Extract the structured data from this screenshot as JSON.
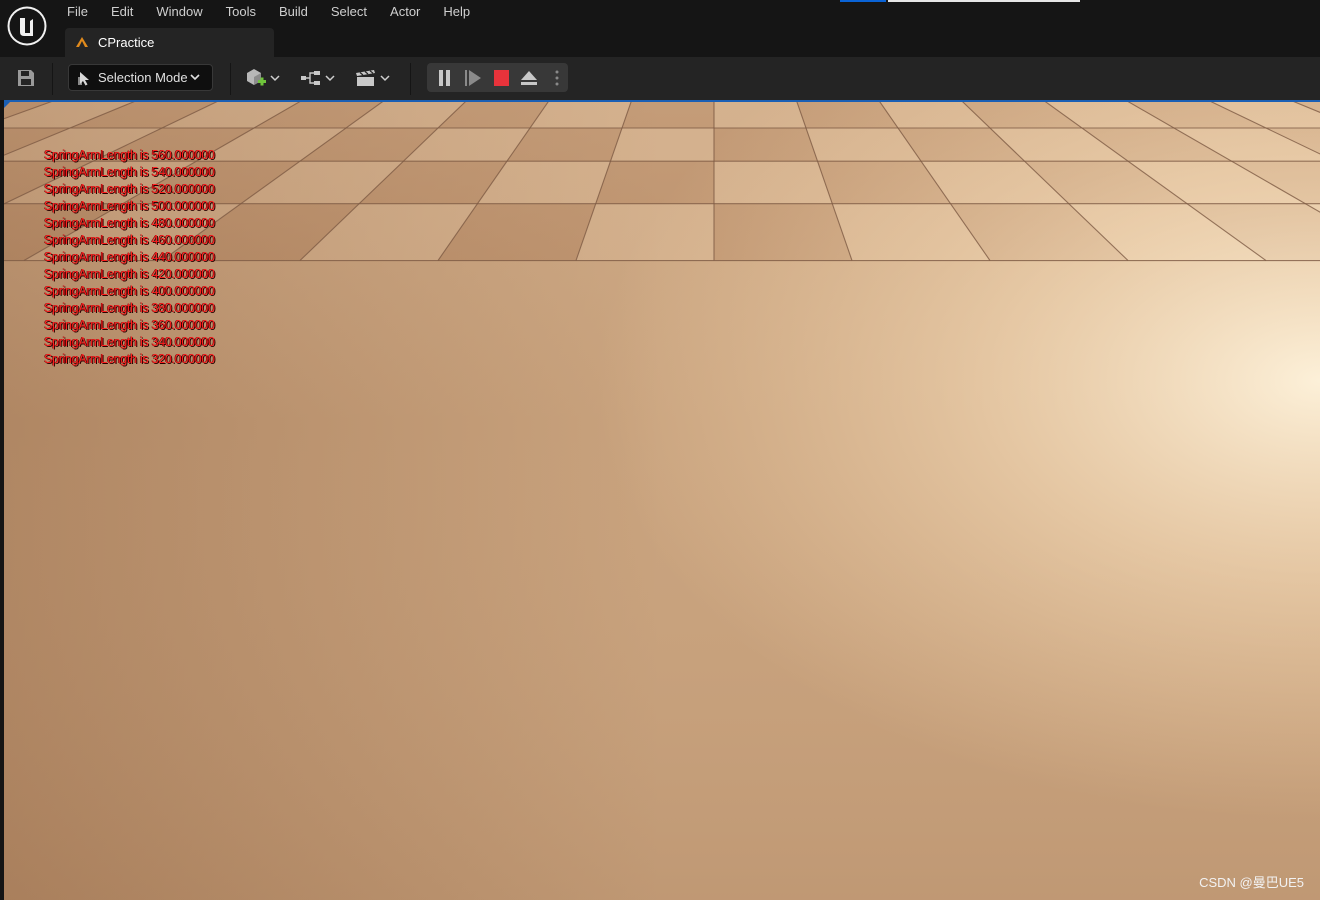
{
  "menu": [
    "File",
    "Edit",
    "Window",
    "Tools",
    "Build",
    "Select",
    "Actor",
    "Help"
  ],
  "top_progress": 0.19,
  "tab": {
    "label": "CPractice",
    "icon": "level-map-icon"
  },
  "toolbar": {
    "save_icon": "save-icon",
    "selection_mode_label": "Selection Mode",
    "add_icon": "add-actor-icon",
    "blueprint_icon": "blueprint-icon",
    "cinematics_icon": "clapperboard-icon",
    "play_controls": [
      "pause-icon",
      "frame-skip-icon",
      "stop-icon",
      "eject-icon",
      "more-options-icon"
    ]
  },
  "colors": {
    "accent": "#0a63d6",
    "stop": "#e8333b",
    "log_text": "#ff1f1f",
    "floor": "#c9a37e"
  },
  "log": {
    "lines": [
      "SpringArmLength is 560.000000",
      "SpringArmLength is 540.000000",
      "SpringArmLength is 520.000000",
      "SpringArmLength is 500.000000",
      "SpringArmLength is 480.000000",
      "SpringArmLength is 460.000000",
      "SpringArmLength is 440.000000",
      "SpringArmLength is 420.000000",
      "SpringArmLength is 400.000000",
      "SpringArmLength is 380.000000",
      "SpringArmLength is 360.000000",
      "SpringArmLength is 340.000000",
      "SpringArmLength is 320.000000"
    ]
  },
  "watermark": "CSDN @曼巴UE5"
}
